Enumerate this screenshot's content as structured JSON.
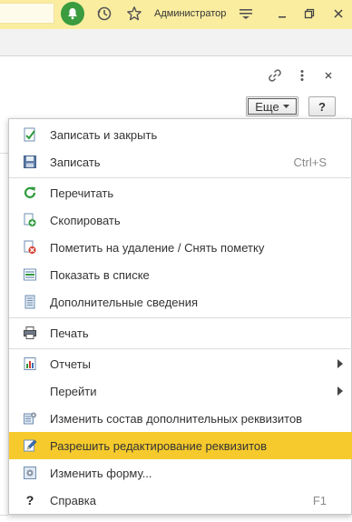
{
  "header": {
    "username": "Администратор"
  },
  "form": {
    "more_label": "Еще",
    "help_label": "?"
  },
  "menu": {
    "items": [
      {
        "label": "Записать и закрыть",
        "shortcut": "",
        "icon": "save-close-icon"
      },
      {
        "label": "Записать",
        "shortcut": "Ctrl+S",
        "icon": "floppy-icon"
      },
      {
        "label": "Перечитать",
        "shortcut": "",
        "icon": "refresh-icon"
      },
      {
        "label": "Скопировать",
        "shortcut": "",
        "icon": "copy-icon"
      },
      {
        "label": "Пометить на удаление / Снять пометку",
        "shortcut": "",
        "icon": "delete-mark-icon"
      },
      {
        "label": "Показать в списке",
        "shortcut": "",
        "icon": "show-in-list-icon"
      },
      {
        "label": "Дополнительные сведения",
        "shortcut": "",
        "icon": "additional-info-icon"
      },
      {
        "label": "Печать",
        "shortcut": "",
        "icon": "print-icon"
      },
      {
        "label": "Отчеты",
        "shortcut": "",
        "icon": "reports-icon",
        "submenu": true
      },
      {
        "label": "Перейти",
        "shortcut": "",
        "icon": "",
        "submenu": true
      },
      {
        "label": "Изменить состав дополнительных реквизитов",
        "shortcut": "",
        "icon": "edit-attributes-icon"
      },
      {
        "label": "Разрешить редактирование реквизитов",
        "shortcut": "",
        "icon": "allow-edit-icon",
        "active": true
      },
      {
        "label": "Изменить форму...",
        "shortcut": "",
        "icon": "change-form-icon"
      },
      {
        "label": "Справка",
        "shortcut": "F1",
        "icon": "help-icon"
      }
    ]
  },
  "colors": {
    "topbar": "#fbeda0",
    "active_item": "#f6ca2c",
    "bell": "#3a9c3f"
  }
}
